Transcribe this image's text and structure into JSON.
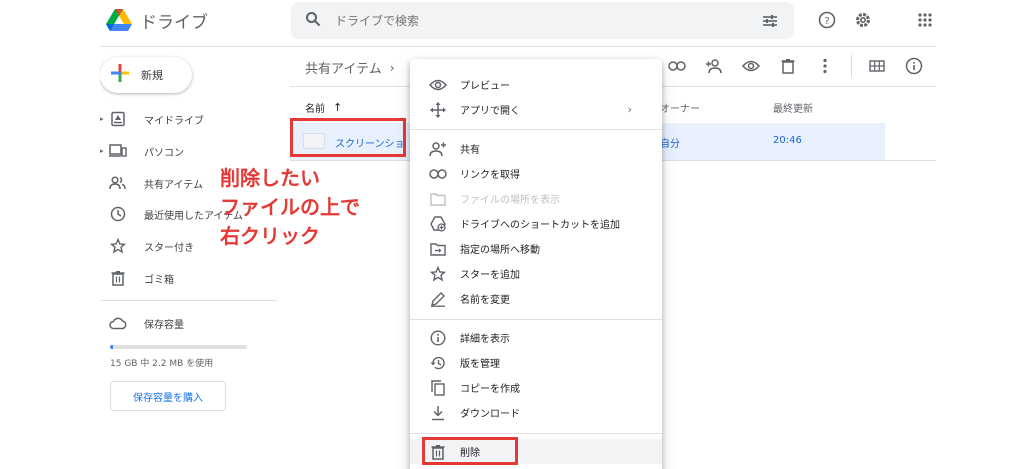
{
  "app": {
    "name": "ドライブ",
    "logo_colors": [
      "#0066da",
      "#00ac47",
      "#ea4335",
      "#ffba00"
    ]
  },
  "search": {
    "placeholder": "ドライブで検索"
  },
  "sidebar": {
    "new_label": "新規",
    "items": [
      {
        "label": "マイドライブ",
        "icon": "my-drive-icon",
        "expandable": true
      },
      {
        "label": "パソコン",
        "icon": "computer-icon",
        "expandable": true
      },
      {
        "label": "共有アイテム",
        "icon": "shared-people-icon",
        "expandable": false
      },
      {
        "label": "最近使用したアイテム",
        "icon": "clock-icon",
        "expandable": false
      },
      {
        "label": "スター付き",
        "icon": "star-icon",
        "expandable": false
      },
      {
        "label": "ゴミ箱",
        "icon": "trash-icon",
        "expandable": false
      }
    ],
    "storage_label": "保存容量",
    "storage_usage": "15 GB 中 2.2 MB を使用",
    "storage_fraction": 0.02,
    "buy_label": "保存容量を購入"
  },
  "main": {
    "breadcrumb": "共有アイテム",
    "columns": {
      "name": "名前",
      "owner": "オーナー",
      "modified": "最終更新"
    },
    "rows": [
      {
        "name": "スクリーンショ",
        "owner": "自分",
        "modified": "20:46"
      }
    ]
  },
  "annotation": {
    "lines": [
      "削除したい",
      "ファイルの上で",
      "右クリック"
    ],
    "color": "#e53935"
  },
  "context_menu": {
    "groups": [
      [
        {
          "label": "プレビュー",
          "icon": "eye-icon"
        },
        {
          "label": "アプリで開く",
          "icon": "move-arrows-icon",
          "submenu": "›"
        }
      ],
      [
        {
          "label": "共有",
          "icon": "add-person-icon"
        },
        {
          "label": "リンクを取得",
          "icon": "link-icon"
        },
        {
          "label": "ファイルの場所を表示",
          "icon": "folder-icon",
          "disabled": true
        },
        {
          "label": "ドライブへのショートカットを追加",
          "icon": "add-shortcut-icon"
        },
        {
          "label": "指定の場所へ移動",
          "icon": "move-to-folder-icon"
        },
        {
          "label": "スターを追加",
          "icon": "star-icon"
        },
        {
          "label": "名前を変更",
          "icon": "pencil-icon"
        }
      ],
      [
        {
          "label": "詳細を表示",
          "icon": "info-icon"
        },
        {
          "label": "版を管理",
          "icon": "history-icon"
        },
        {
          "label": "コピーを作成",
          "icon": "copy-icon"
        },
        {
          "label": "ダウンロード",
          "icon": "download-icon"
        }
      ],
      [
        {
          "label": "削除",
          "icon": "trash-icon",
          "highlighted": true
        }
      ]
    ]
  }
}
